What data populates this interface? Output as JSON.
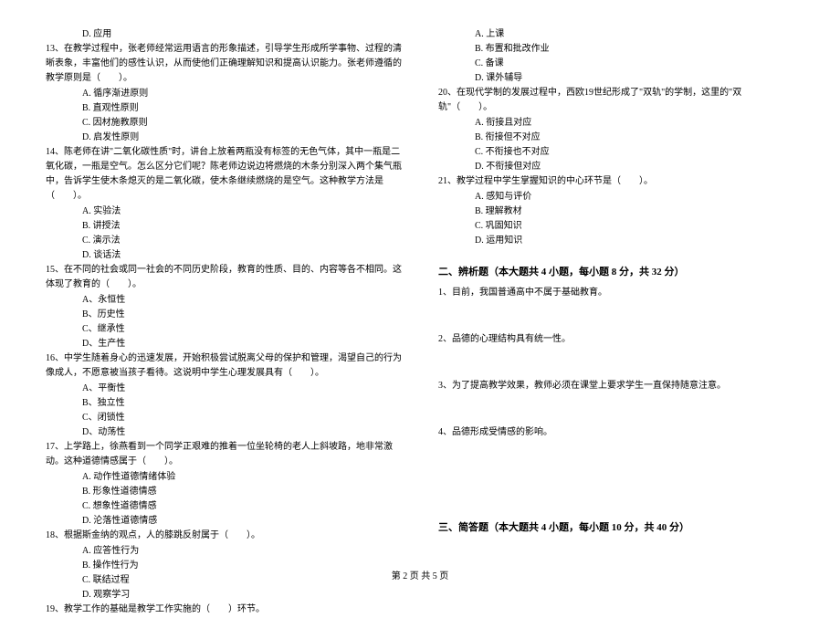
{
  "left": {
    "q12_optD": "D. 应用",
    "q13_stem": "13、在教学过程中，张老师经常运用语言的形象描述，引导学生形成所学事物、过程的清晰表象，丰富他们的感性认识，从而使他们正确理解知识和提高认识能力。张老师遵循的教学原则是（　　）。",
    "q13_optA": "A. 循序渐进原则",
    "q13_optB": "B. 直观性原则",
    "q13_optC": "C. 因材施教原则",
    "q13_optD": "D. 启发性原则",
    "q14_stem": "14、陈老师在讲\"二氧化碳性质\"时，讲台上放着两瓶没有标签的无色气体，其中一瓶是二氧化碳，一瓶是空气。怎么区分它们呢？陈老师边说边将燃烧的木条分别深入两个集气瓶中，告诉学生使木条熄灭的是二氧化碳，使木条继续燃烧的是空气。这种教学方法是（　　）。",
    "q14_optA": "A. 实验法",
    "q14_optB": "B. 讲授法",
    "q14_optC": "C. 演示法",
    "q14_optD": "D. 谈话法",
    "q15_stem": "15、在不同的社会或同一社会的不同历史阶段，教育的性质、目的、内容等各不相同。这体现了教育的（　　）。",
    "q15_optA": "A、永恒性",
    "q15_optB": "B、历史性",
    "q15_optC": "C、继承性",
    "q15_optD": "D、生产性",
    "q16_stem": "16、中学生随着身心的迅速发展，开始积极尝试脱离父母的保护和管理，渴望自己的行为像成人，不愿意被当孩子看待。这说明中学生心理发展具有（　　）。",
    "q16_optA": "A、平衡性",
    "q16_optB": "B、独立性",
    "q16_optC": "C、闭锁性",
    "q16_optD": "D、动荡性",
    "q17_stem": "17、上学路上，徐燕看到一个同学正艰难的推着一位坐轮椅的老人上斜坡路，地非常激动。这种道德情感属于（　　）。",
    "q17_optA": "A. 动作性道德情绪体验",
    "q17_optB": "B. 形象性道德情感",
    "q17_optC": "C. 想象性道德情感",
    "q17_optD": "D. 沦落性道德情感",
    "q18_stem": "18、根据斯金纳的观点，人的膝跳反射属于（　　）。",
    "q18_optA": "A. 应答性行为",
    "q18_optB": "B. 操作性行为",
    "q18_optC": "C. 联结过程",
    "q18_optD": "D. 观察学习",
    "q19_stem": "19、教学工作的基础是教学工作实施的（　　）环节。"
  },
  "right": {
    "q19_optA": "A. 上课",
    "q19_optB": "B. 布置和批改作业",
    "q19_optC": "C. 备课",
    "q19_optD": "D. 课外辅导",
    "q20_stem": "20、在现代学制的发展过程中，西欧19世纪形成了\"双轨\"的学制，这里的\"双轨\"（　　）。",
    "q20_optA": "A. 衔接且对应",
    "q20_optB": "B. 衔接但不对应",
    "q20_optC": "C. 不衔接也不对应",
    "q20_optD": "D. 不衔接但对应",
    "q21_stem": "21、教学过程中学生掌握知识的中心环节是（　　）。",
    "q21_optA": "A. 感知与评价",
    "q21_optB": "B. 理解教材",
    "q21_optC": "C. 巩固知识",
    "q21_optD": "D. 运用知识",
    "sec2_title": "二、辨析题（本大题共 4 小题，每小题 8 分，共 32 分）",
    "sec2_q1": "1、目前，我国普通高中不属于基础教育。",
    "sec2_q2": "2、品德的心理结构具有统一性。",
    "sec2_q3": "3、为了提高教学效果，教师必须在课堂上要求学生一直保持随意注意。",
    "sec2_q4": "4、品德形成受情感的影响。",
    "sec3_title": "三、简答题（本大题共 4 小题，每小题 10 分，共 40 分）"
  },
  "footer": "第 2 页 共 5 页"
}
